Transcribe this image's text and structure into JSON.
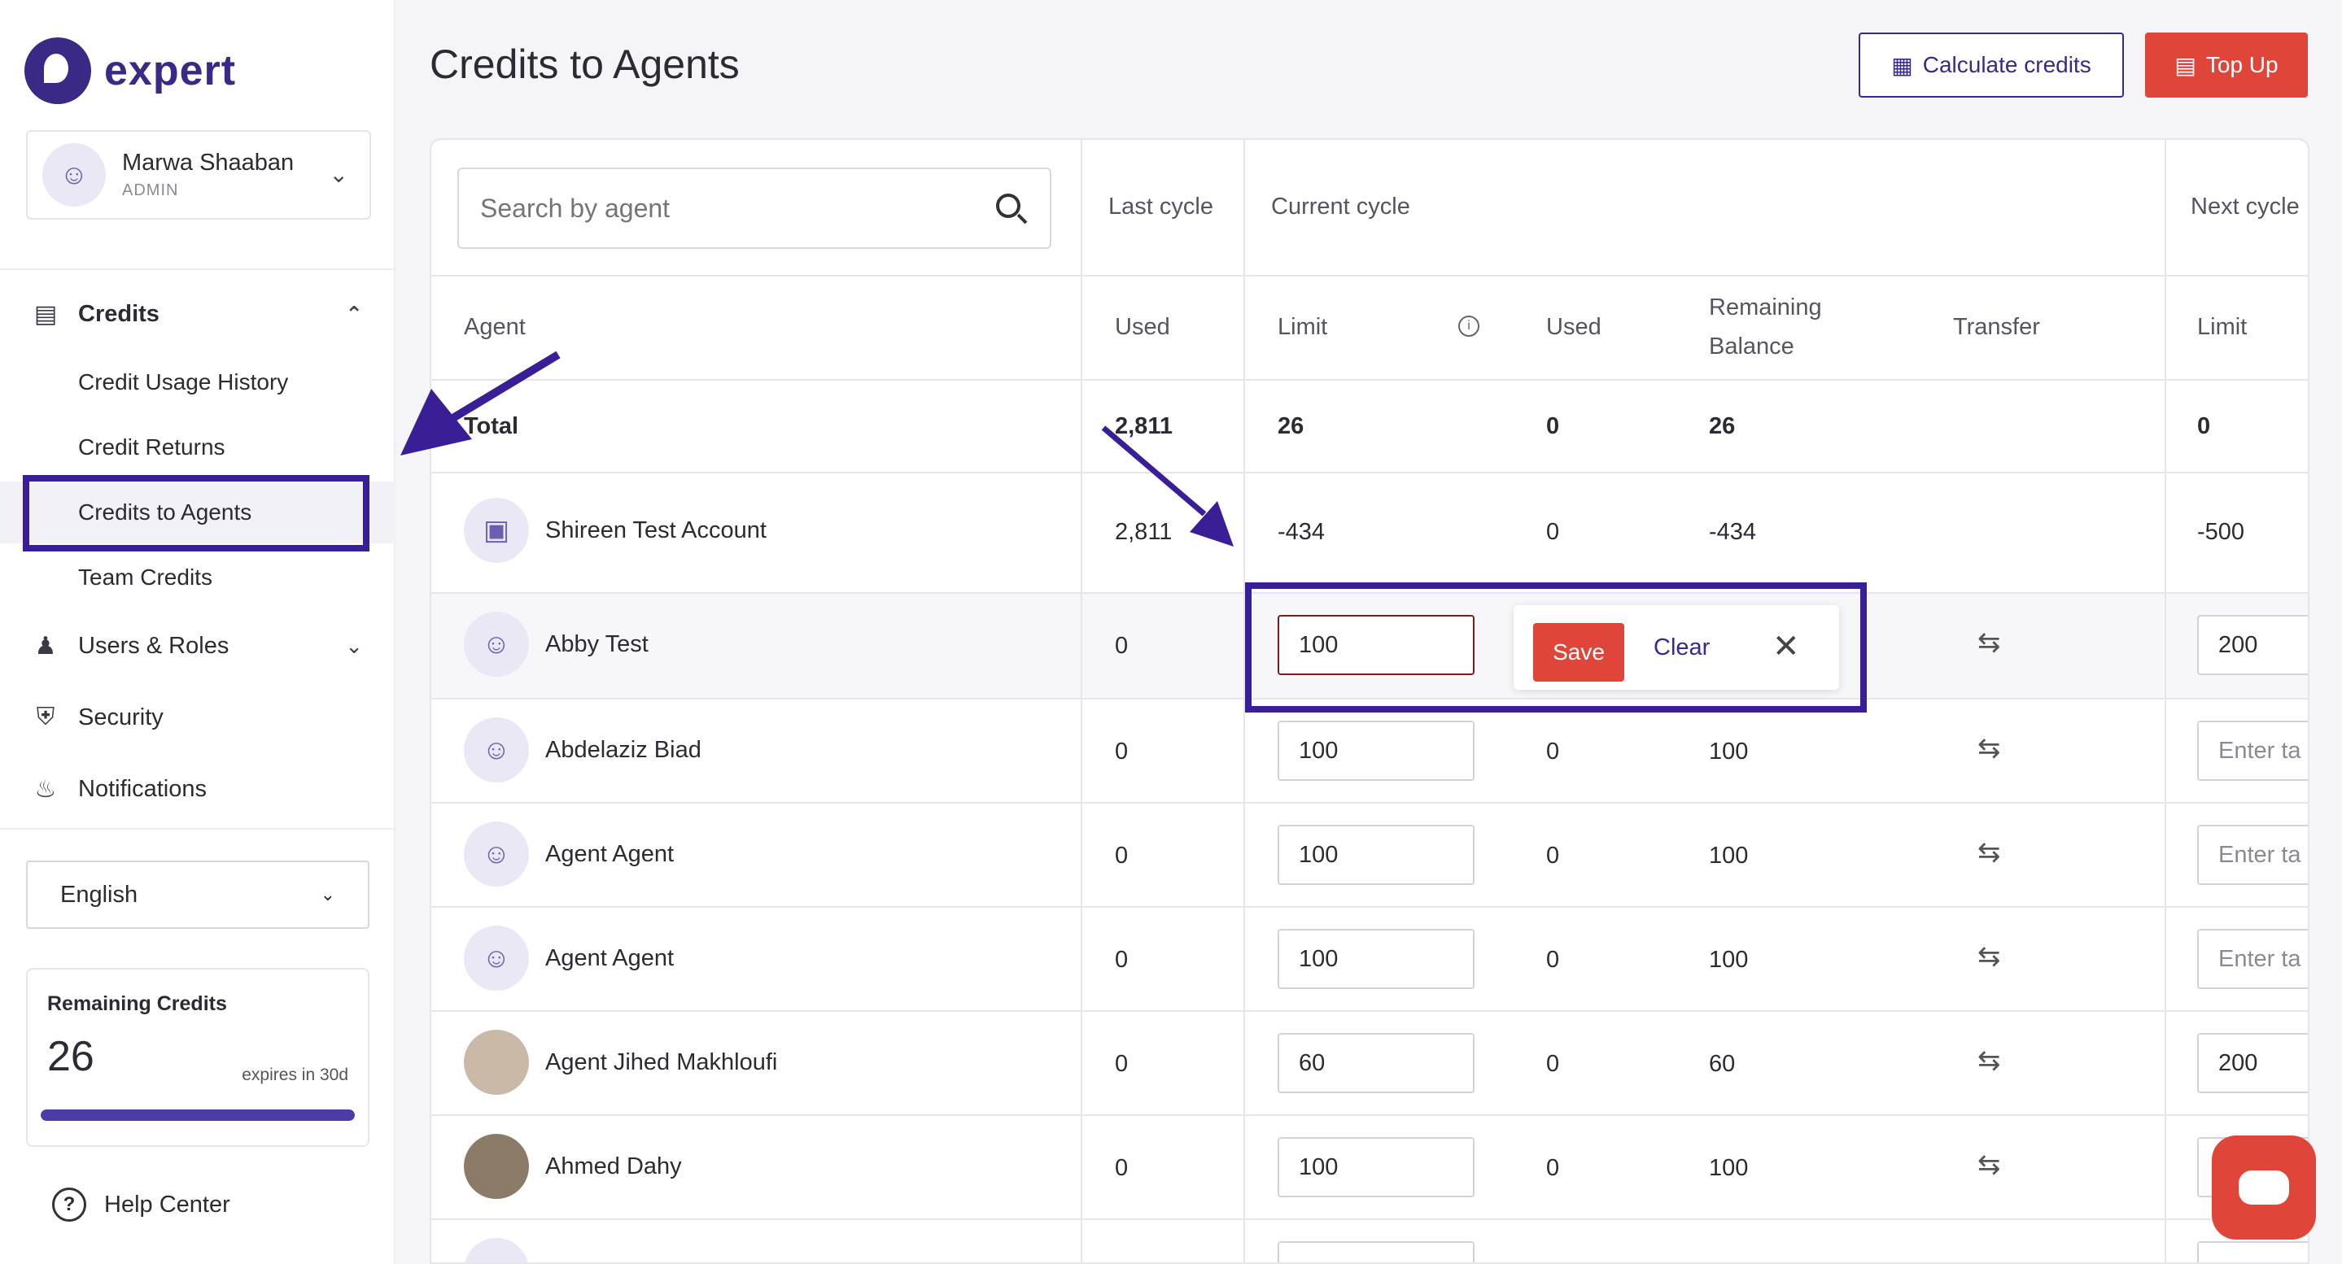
{
  "brand": {
    "name": "expert"
  },
  "user": {
    "name": "Marwa Shaaban",
    "role": "ADMIN"
  },
  "nav": {
    "credits": {
      "label": "Credits",
      "items": [
        "Credit Usage History",
        "Credit Returns",
        "Credits to Agents",
        "Team Credits"
      ]
    },
    "users_roles": "Users & Roles",
    "security": "Security",
    "notifications": "Notifications"
  },
  "language": {
    "selected": "English"
  },
  "remaining_credits": {
    "title": "Remaining Credits",
    "value": "26",
    "expires": "expires in 30d",
    "progress": 1.0
  },
  "help": "Help Center",
  "page": {
    "title": "Credits to Agents",
    "calc_button": "Calculate credits",
    "topup_button": "Top Up"
  },
  "search": {
    "placeholder": "Search by agent"
  },
  "table": {
    "group_headers": {
      "last_cycle": "Last cycle",
      "current_cycle": "Current cycle",
      "next_cycle": "Next cycle"
    },
    "columns": {
      "agent": "Agent",
      "last_used": "Used",
      "limit": "Limit",
      "used": "Used",
      "remaining": "Remaining",
      "remaining2": "Balance",
      "transfer": "Transfer",
      "next_limit": "Limit"
    },
    "total": {
      "label": "Total",
      "last_used": "2,811",
      "limit": "26",
      "used": "0",
      "remaining": "26",
      "next_limit": "0"
    },
    "account": {
      "name": "Shireen Test Account",
      "last_used": "2,811",
      "limit": "-434",
      "used": "0",
      "remaining": "-434",
      "next_limit": "-500"
    },
    "rows": [
      {
        "name": "Abby Test",
        "last_used": "0",
        "limit": "100",
        "used": "",
        "remaining": "",
        "next_limit": "200"
      },
      {
        "name": "Abdelaziz Biad",
        "last_used": "0",
        "limit": "100",
        "used": "0",
        "remaining": "100",
        "next_limit": ""
      },
      {
        "name": "Agent Agent",
        "last_used": "0",
        "limit": "100",
        "used": "0",
        "remaining": "100",
        "next_limit": ""
      },
      {
        "name": "Agent Agent",
        "last_used": "0",
        "limit": "100",
        "used": "0",
        "remaining": "100",
        "next_limit": ""
      },
      {
        "name": "Agent Jihed Makhloufi",
        "last_used": "0",
        "limit": "60",
        "used": "0",
        "remaining": "60",
        "next_limit": "200"
      },
      {
        "name": "Ahmed Dahy",
        "last_used": "0",
        "limit": "100",
        "used": "0",
        "remaining": "100",
        "next_limit": ""
      }
    ],
    "next_placeholder": "Enter ta"
  },
  "edit_popup": {
    "save": "Save",
    "clear": "Clear"
  },
  "colors": {
    "brand": "#3a2a86",
    "accent": "#e0453a",
    "annotation": "#3a1e96"
  }
}
